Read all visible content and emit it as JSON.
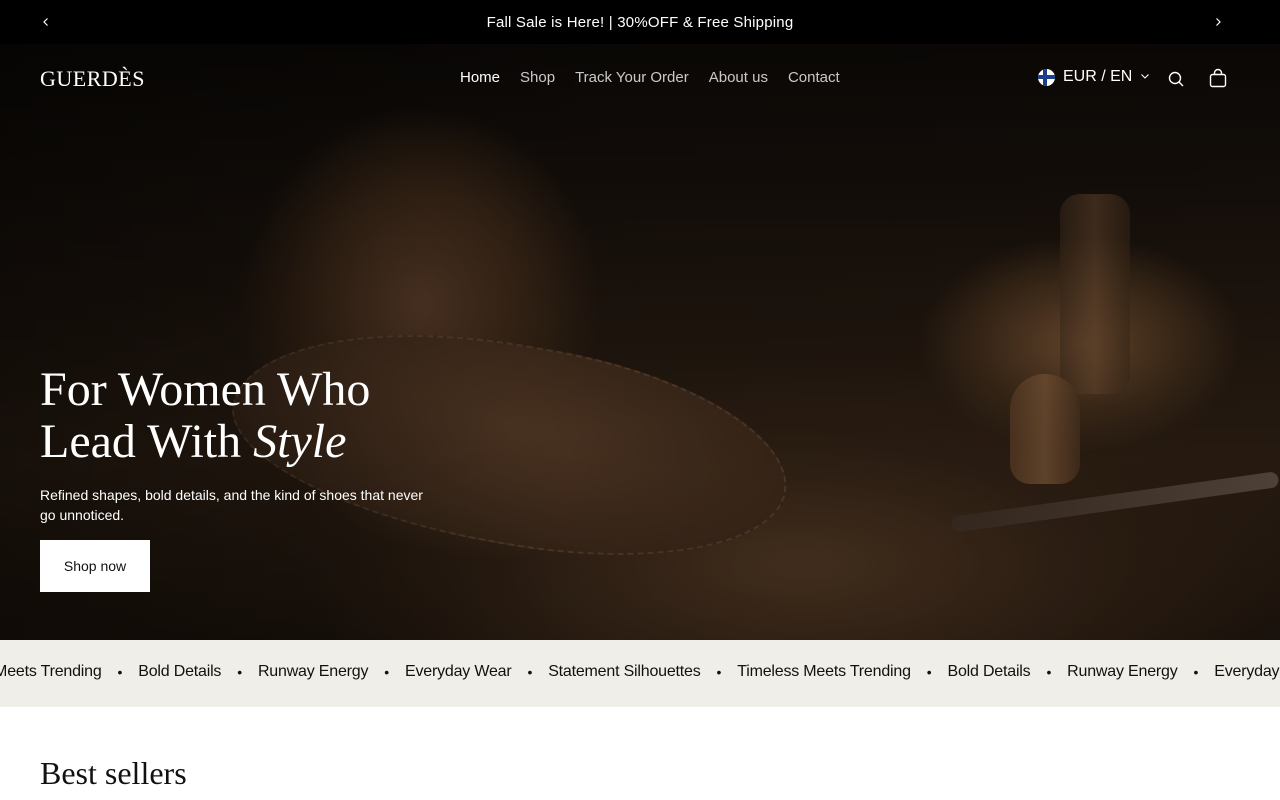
{
  "announcement": {
    "text": "Fall Sale is Here! | 30%OFF & Free Shipping",
    "prev_icon": "chevron-left-icon",
    "next_icon": "chevron-right-icon"
  },
  "header": {
    "logo": "GUERDÈS",
    "nav": [
      {
        "label": "Home",
        "active": true
      },
      {
        "label": "Shop",
        "active": false
      },
      {
        "label": "Track Your Order",
        "active": false
      },
      {
        "label": "About us",
        "active": false
      },
      {
        "label": "Contact",
        "active": false
      }
    ],
    "locale": "EUR / EN",
    "search_icon": "search-icon",
    "cart_icon": "cart-icon"
  },
  "hero": {
    "title_line1": "For Women Who",
    "title_line2_plain": "Lead With ",
    "title_line2_italic": "Style",
    "subtitle": "Refined shapes, bold details, and the kind of shoes that never go unnoticed.",
    "cta": "Shop now"
  },
  "marquee": {
    "items": [
      "Timeless Meets Trending",
      "Bold Details",
      "Runway Energy",
      "Everyday Wear",
      "Statement Silhouettes",
      "Timeless Meets Trending",
      "Bold Details",
      "Runway Energy",
      "Everyday Wear"
    ],
    "separator": "•"
  },
  "best_sellers": {
    "title": "Best sellers"
  }
}
